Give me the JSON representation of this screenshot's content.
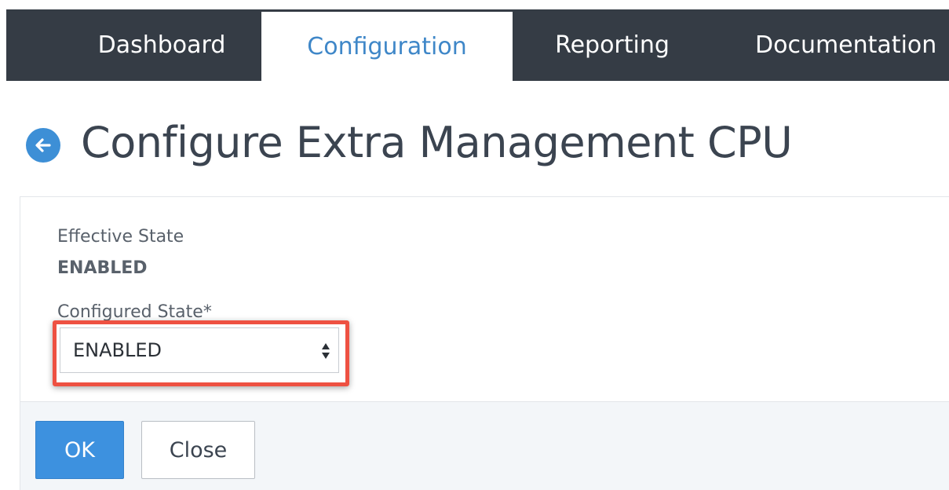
{
  "nav": {
    "tabs": [
      {
        "label": "Dashboard",
        "active": false
      },
      {
        "label": "Configuration",
        "active": true
      },
      {
        "label": "Reporting",
        "active": false
      },
      {
        "label": "Documentation",
        "active": false
      }
    ]
  },
  "page": {
    "title": "Configure Extra Management CPU",
    "back_icon": "arrow-left-circle-icon"
  },
  "form": {
    "effective_state_label": "Effective State",
    "effective_state_value": "ENABLED",
    "configured_state_label": "Configured State*",
    "configured_state_value": "ENABLED"
  },
  "actions": {
    "ok_label": "OK",
    "close_label": "Close"
  },
  "colors": {
    "nav_bg": "#353c45",
    "active_tab_text": "#3f87c8",
    "accent": "#3d91df",
    "highlight": "#ee5142"
  }
}
